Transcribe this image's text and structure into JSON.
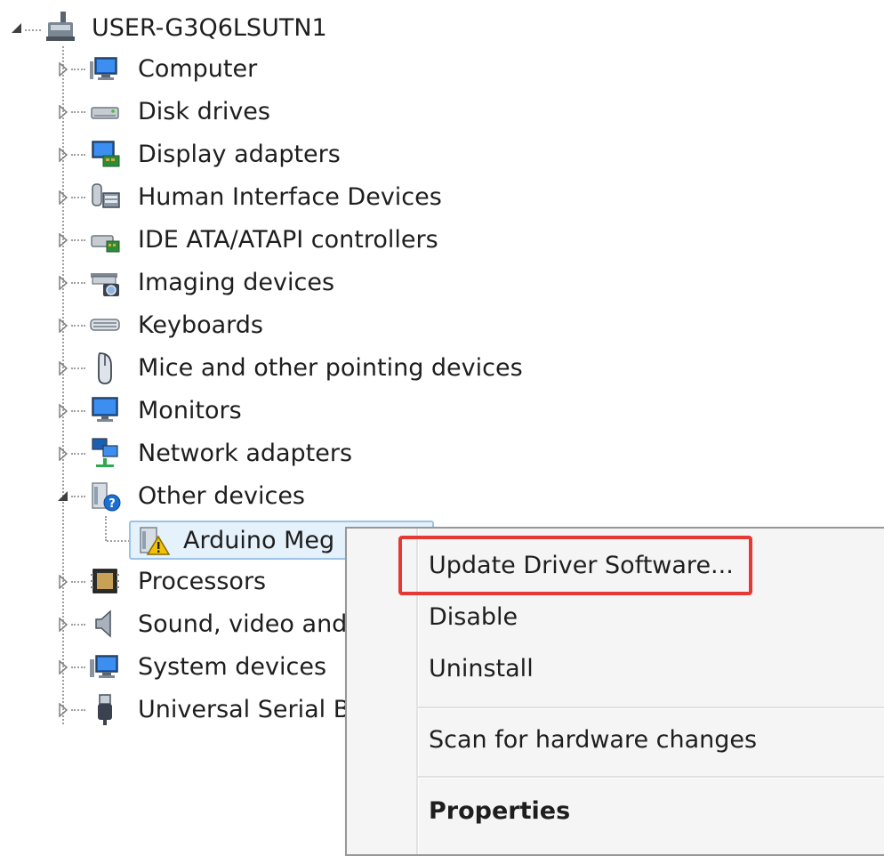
{
  "tree": {
    "root": "USER-G3Q6LSUTN1",
    "categories": [
      {
        "label": "Computer",
        "icon": "computer-icon"
      },
      {
        "label": "Disk drives",
        "icon": "disk-drive-icon"
      },
      {
        "label": "Display adapters",
        "icon": "display-adapter-icon"
      },
      {
        "label": "Human Interface Devices",
        "icon": "hid-icon"
      },
      {
        "label": "IDE ATA/ATAPI controllers",
        "icon": "ide-controller-icon"
      },
      {
        "label": "Imaging devices",
        "icon": "camera-icon"
      },
      {
        "label": "Keyboards",
        "icon": "keyboard-icon"
      },
      {
        "label": "Mice and other pointing devices",
        "icon": "mouse-icon"
      },
      {
        "label": "Monitors",
        "icon": "monitor-icon"
      },
      {
        "label": "Network adapters",
        "icon": "network-icon"
      },
      {
        "label": "Other devices",
        "icon": "unknown-device-icon"
      },
      {
        "label": "Processors",
        "icon": "processor-icon"
      },
      {
        "label": "Sound, video and",
        "icon": "speaker-icon"
      },
      {
        "label": "System devices",
        "icon": "system-icon"
      },
      {
        "label": "Universal Serial B",
        "icon": "usb-icon"
      }
    ],
    "child_device": {
      "label": "Arduino Meg",
      "icon": "warning-device-icon"
    }
  },
  "context_menu": {
    "items": [
      {
        "label": "Update Driver Software...",
        "bold": false
      },
      {
        "label": "Disable",
        "bold": false
      },
      {
        "label": "Uninstall",
        "bold": false
      },
      {
        "label": "Scan for hardware changes",
        "bold": false
      },
      {
        "label": "Properties",
        "bold": true
      }
    ]
  },
  "colors": {
    "highlight": "#e53935",
    "selection": "#e5f1fb",
    "selection_border": "#9dc3e6"
  }
}
